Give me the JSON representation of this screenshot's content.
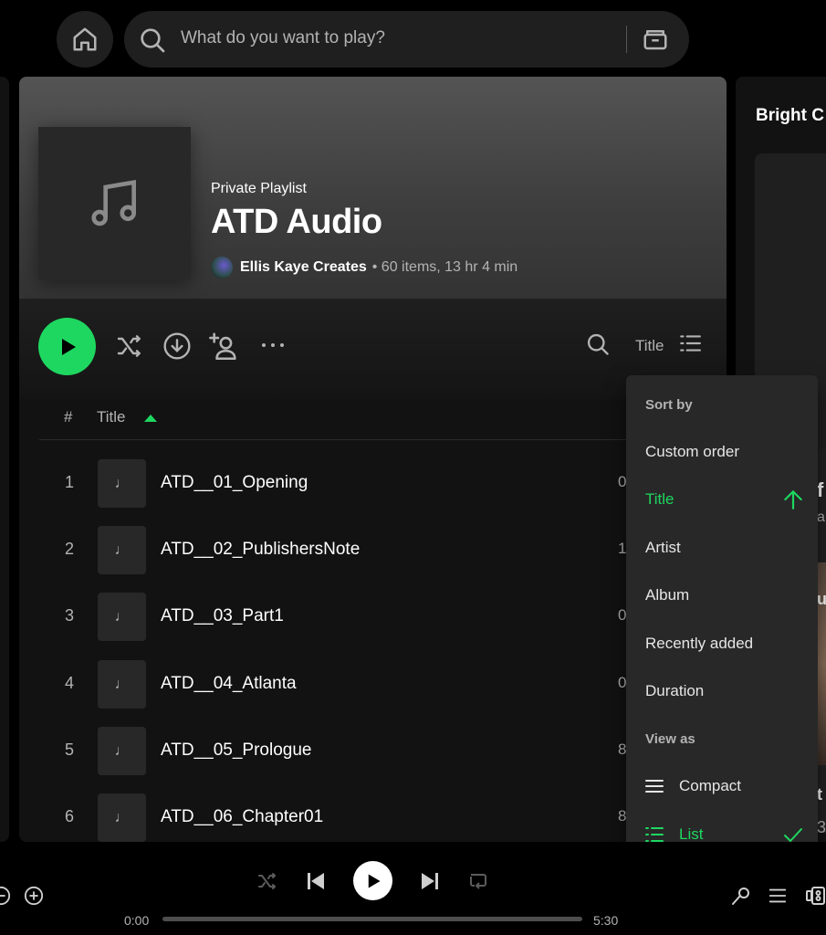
{
  "search": {
    "placeholder": "What do you want to play?"
  },
  "playlist": {
    "type": "Private Playlist",
    "title": "ATD Audio",
    "owner": "Ellis Kaye Creates",
    "meta": "• 60 items, 13 hr 4 min"
  },
  "toolbar": {
    "sort_label": "Title"
  },
  "table": {
    "hash": "#",
    "title_header": "Title",
    "rows": [
      {
        "num": "1",
        "title": "ATD__01_Opening",
        "dur": "0"
      },
      {
        "num": "2",
        "title": "ATD__02_PublishersNote",
        "dur": "1"
      },
      {
        "num": "3",
        "title": "ATD__03_Part1",
        "dur": "0"
      },
      {
        "num": "4",
        "title": "ATD__04_Atlanta",
        "dur": "0"
      },
      {
        "num": "5",
        "title": "ATD__05_Prologue",
        "dur": "8"
      },
      {
        "num": "6",
        "title": "ATD__06_Chapter01",
        "dur": "8"
      }
    ],
    "thumb_glyph": "♩"
  },
  "right_panel": {
    "title": "Bright C",
    "frag1": "f",
    "frag2": "a",
    "frag3": "ut",
    "frag4": "t",
    "frag5": "3"
  },
  "sort_menu": {
    "sort_by_heading": "Sort by",
    "sort_options": [
      "Custom order",
      "Title",
      "Artist",
      "Album",
      "Recently added",
      "Duration"
    ],
    "active_sort": "Title",
    "view_as_heading": "View as",
    "view_options": [
      "Compact",
      "List"
    ],
    "active_view": "List"
  },
  "player": {
    "elapsed": "0:00",
    "total": "5:30"
  },
  "colors": {
    "accent": "#1ed760",
    "background": "#121212",
    "menu": "#282828"
  }
}
